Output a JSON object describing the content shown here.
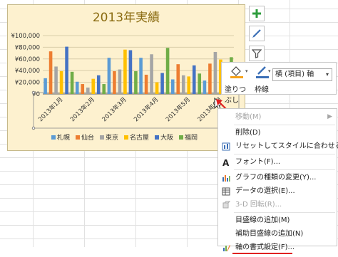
{
  "chart": {
    "title": "2013年実績",
    "y_ticks": [
      "¥100,000",
      "¥80,000",
      "¥60,000",
      "¥40,000",
      "¥20,000",
      "¥0"
    ],
    "months": [
      "2013年1月",
      "2013年2月",
      "2013年3月",
      "2013年4月",
      "2013年5月",
      "2013年6月"
    ],
    "legend": [
      "札幌",
      "仙台",
      "東京",
      "名古屋",
      "大阪",
      "福岡"
    ],
    "colors": [
      "#5b9bd5",
      "#ed7d31",
      "#a5a5a5",
      "#ffc000",
      "#4472c4",
      "#70ad47"
    ]
  },
  "chart_data": {
    "type": "bar",
    "title": "2013年実績",
    "categories": [
      "2013年1月",
      "2013年2月",
      "2013年3月",
      "2013年4月",
      "2013年5月",
      "2013年6月"
    ],
    "ylim": [
      0,
      100000
    ],
    "legend_position": "bottom",
    "series": [
      {
        "name": "札幌",
        "values": [
          27000,
          21000,
          62000,
          62000,
          25000,
          23000
        ]
      },
      {
        "name": "仙台",
        "values": [
          73000,
          17000,
          39000,
          33000,
          51000,
          52000
        ]
      },
      {
        "name": "東京",
        "values": [
          47000,
          11000,
          42000,
          68000,
          32000,
          72000
        ]
      },
      {
        "name": "名古屋",
        "values": [
          39000,
          26000,
          76000,
          20000,
          30000,
          59000
        ]
      },
      {
        "name": "大阪",
        "values": [
          81000,
          32000,
          75000,
          36000,
          49000,
          0
        ]
      },
      {
        "name": "福岡",
        "values": [
          38000,
          17000,
          39000,
          79000,
          35000,
          63000
        ]
      }
    ]
  },
  "side_buttons": [
    "plus-icon",
    "brush-icon",
    "filter-icon"
  ],
  "format_bar": {
    "fill_label": "塗りつぶし",
    "outline_label": "枠線",
    "selection": "横 (項目) 軸"
  },
  "context_menu": [
    {
      "label": "移動(M)",
      "icon": "",
      "disabled": true,
      "arrow": true
    },
    {
      "label": "削除(D)",
      "icon": "",
      "disabled": false
    },
    {
      "label": "リセットしてスタイルに合わせる(A)",
      "icon": "reset-style-icon",
      "disabled": false
    },
    {
      "label": "フォント(F)...",
      "icon": "font-icon",
      "disabled": false
    },
    {
      "label": "グラフの種類の変更(Y)...",
      "icon": "chart-type-icon",
      "disabled": false
    },
    {
      "label": "データの選択(E)...",
      "icon": "select-data-icon",
      "disabled": false
    },
    {
      "label": "3-D 回転(R)...",
      "icon": "rotate-3d-icon",
      "disabled": true
    },
    {
      "label": "目盛線の追加(M)",
      "icon": "",
      "disabled": false
    },
    {
      "label": "補助目盛線の追加(N)",
      "icon": "",
      "disabled": false
    },
    {
      "label": "軸の書式設定(F)...",
      "icon": "format-axis-icon",
      "disabled": false
    }
  ]
}
